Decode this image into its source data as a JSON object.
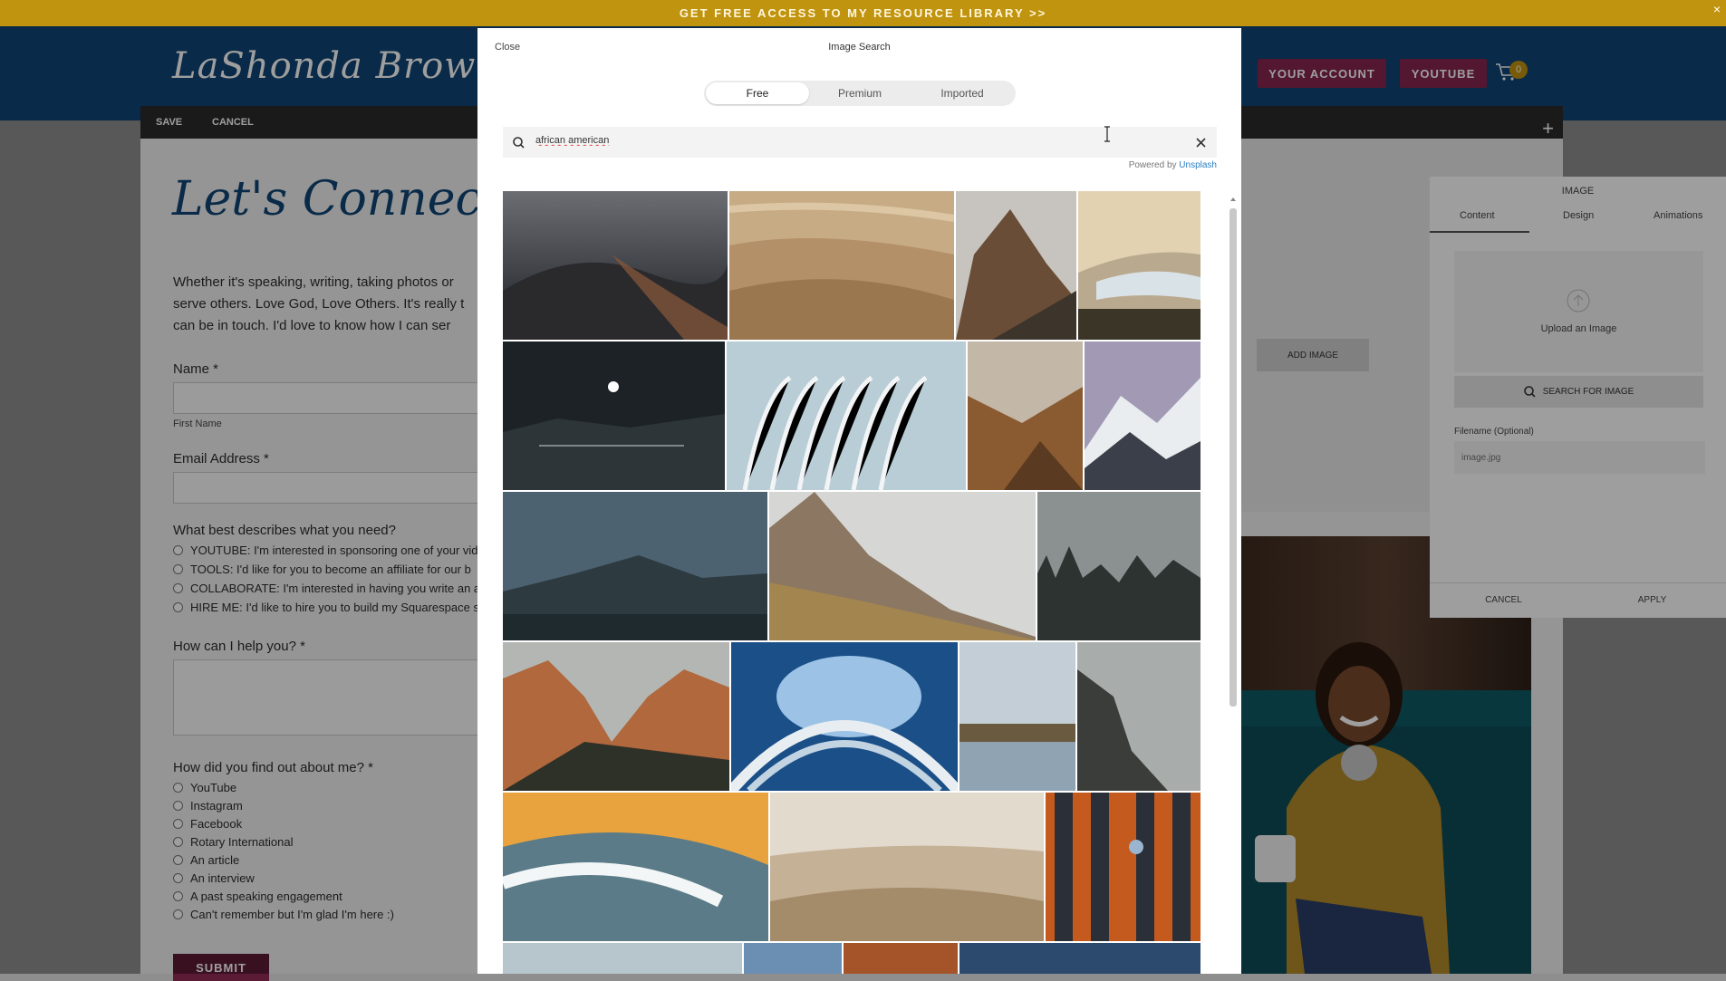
{
  "announcement": {
    "text": "GET FREE ACCESS TO MY RESOURCE LIBRARY >>",
    "close": "×"
  },
  "site": {
    "logo": "LaShonda Brown",
    "nav": {
      "account": "YOUR ACCOUNT",
      "youtube": "YOUTUBE"
    },
    "cart_count": "0"
  },
  "editor_bar": {
    "save": "SAVE",
    "cancel": "CANCEL",
    "add": "+"
  },
  "form": {
    "heading": "Let's Connect",
    "intro_lines": [
      "Whether it's speaking, writing, taking photos or",
      "serve others. Love God, Love Others. It's really t",
      "can be in touch. I'd love to know how I can ser"
    ],
    "name_label": "Name *",
    "first_name_label": "First Name",
    "email_label": "Email Address *",
    "need_question": "What best describes what you need?",
    "need_options": [
      "YOUTUBE: I'm interested in sponsoring one of your vid",
      "TOOLS: I'd like for you to become an affiliate for our b",
      "COLLABORATE: I'm interested in having you write an a",
      "HIRE ME: I'd like to hire you to build my Squarespace s"
    ],
    "help_label": "How can I help you? *",
    "found_question": "How did you find out about me? *",
    "found_options": [
      "YouTube",
      "Instagram",
      "Facebook",
      "Rotary International",
      "An article",
      "An interview",
      "A past speaking engagement",
      "Can't remember but I'm glad I'm here :)"
    ],
    "submit": "SUBMIT"
  },
  "page_right": {
    "add_image": "ADD IMAGE"
  },
  "image_panel": {
    "title": "IMAGE",
    "tabs": [
      "Content",
      "Design",
      "Animations"
    ],
    "active_tab": "Content",
    "upload_label": "Upload an Image",
    "search_button": "SEARCH FOR IMAGE",
    "filename_label": "Filename (Optional)",
    "filename_placeholder": "image.jpg",
    "cancel": "CANCEL",
    "apply": "APPLY"
  },
  "modal": {
    "close": "Close",
    "title": "Image Search",
    "tabs": [
      "Free",
      "Premium",
      "Imported"
    ],
    "active_tab": "Free",
    "search_value": "african american",
    "powered_by": "Powered by",
    "powered_source": "Unsplash"
  },
  "colors": {
    "announcement": "#c0940e",
    "header": "#0f4574",
    "nav_button": "#87264f",
    "submit": "#5c1b35",
    "link": "#2b7fc3"
  }
}
